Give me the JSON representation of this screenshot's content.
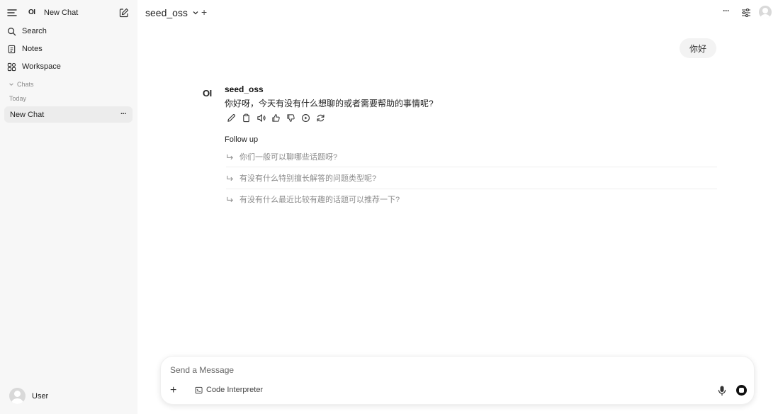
{
  "sidebar": {
    "logo": "OI",
    "title": "New Chat",
    "items": [
      {
        "label": "Search",
        "icon": "search-icon"
      },
      {
        "label": "Notes",
        "icon": "notes-icon"
      },
      {
        "label": "Workspace",
        "icon": "workspace-icon"
      }
    ],
    "section_label": "Chats",
    "group_label": "Today",
    "chats": [
      {
        "label": "New Chat"
      }
    ],
    "chat_more": "···",
    "user_name": "User"
  },
  "topbar": {
    "model_name": "seed_oss",
    "add": "+",
    "more": "···"
  },
  "chat": {
    "user_message": "你好",
    "bot_logo": "OI",
    "bot_name": "seed_oss",
    "bot_message": "你好呀，今天有没有什么想聊的或者需要帮助的事情呢?",
    "followup_title": "Follow up",
    "followups": [
      "你们一般可以聊哪些话题呀?",
      "有没有什么特别擅长解答的问题类型呢?",
      "有没有什么最近比较有趣的话题可以推荐一下?"
    ]
  },
  "composer": {
    "placeholder": "Send a Message",
    "add": "+",
    "code_interpreter": "Code Interpreter"
  },
  "icons": {
    "actions": [
      "edit-icon",
      "copy-icon",
      "speaker-icon",
      "thumbs-up-icon",
      "thumbs-down-icon",
      "play-icon",
      "regenerate-icon"
    ]
  }
}
